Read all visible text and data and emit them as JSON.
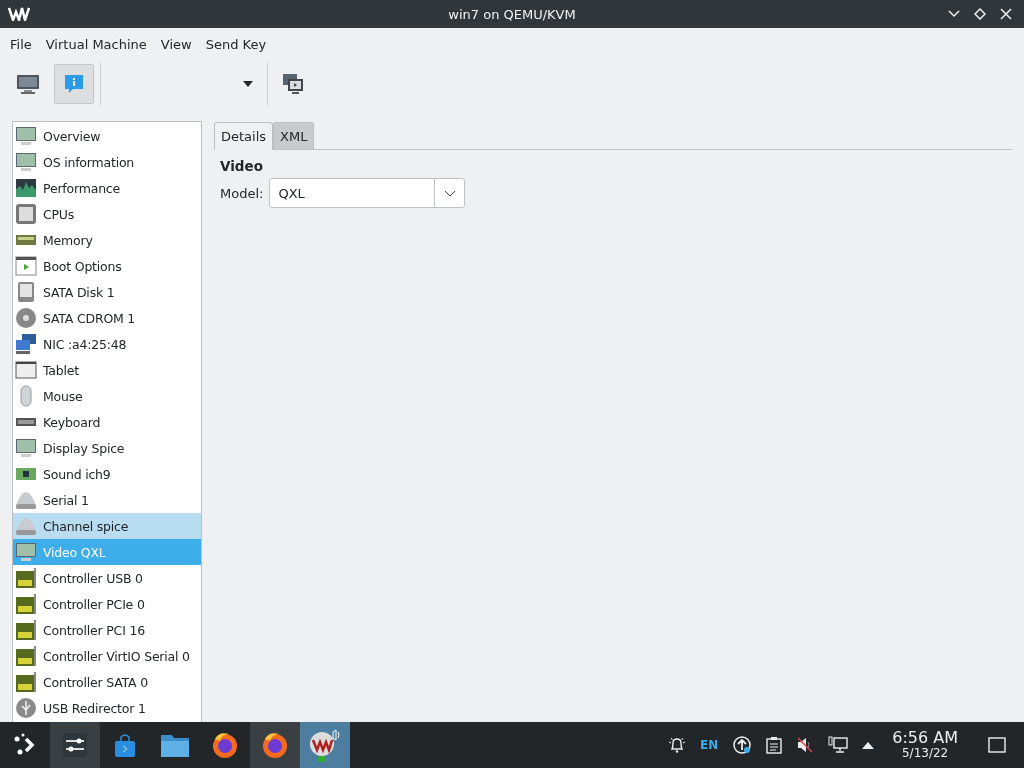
{
  "window": {
    "title": "win7 on QEMU/KVM"
  },
  "menu": [
    "File",
    "Virtual Machine",
    "View",
    "Send Key"
  ],
  "toolbar": {
    "buttons": [
      {
        "kind": "console",
        "selected": false
      },
      {
        "kind": "details",
        "selected": true
      }
    ],
    "dropdown": {
      "kind": "dropdown"
    },
    "extra": {
      "kind": "screens"
    }
  },
  "hardware": [
    {
      "label": "Overview",
      "kind": "monitor",
      "selected": false,
      "hovered": false
    },
    {
      "label": "OS information",
      "kind": "monitor",
      "selected": false,
      "hovered": false
    },
    {
      "label": "Performance",
      "kind": "chart",
      "selected": false,
      "hovered": false
    },
    {
      "label": "CPUs",
      "kind": "chip",
      "selected": false,
      "hovered": false
    },
    {
      "label": "Memory",
      "kind": "memory",
      "selected": false,
      "hovered": false
    },
    {
      "label": "Boot Options",
      "kind": "boot",
      "selected": false,
      "hovered": false
    },
    {
      "label": "SATA Disk 1",
      "kind": "disk",
      "selected": false,
      "hovered": false
    },
    {
      "label": "SATA CDROM 1",
      "kind": "cdrom",
      "selected": false,
      "hovered": false
    },
    {
      "label": "NIC :a4:25:48",
      "kind": "nic",
      "selected": false,
      "hovered": false
    },
    {
      "label": "Tablet",
      "kind": "tablet",
      "selected": false,
      "hovered": false
    },
    {
      "label": "Mouse",
      "kind": "mouse",
      "selected": false,
      "hovered": false
    },
    {
      "label": "Keyboard",
      "kind": "keyboard",
      "selected": false,
      "hovered": false
    },
    {
      "label": "Display Spice",
      "kind": "monitor",
      "selected": false,
      "hovered": false
    },
    {
      "label": "Sound ich9",
      "kind": "sound",
      "selected": false,
      "hovered": false
    },
    {
      "label": "Serial 1",
      "kind": "serial",
      "selected": false,
      "hovered": false
    },
    {
      "label": "Channel spice",
      "kind": "serial",
      "selected": false,
      "hovered": true
    },
    {
      "label": "Video QXL",
      "kind": "monitor",
      "selected": true,
      "hovered": false
    },
    {
      "label": "Controller USB 0",
      "kind": "controller",
      "selected": false,
      "hovered": false
    },
    {
      "label": "Controller PCIe 0",
      "kind": "controller",
      "selected": false,
      "hovered": false
    },
    {
      "label": "Controller PCI 16",
      "kind": "controller",
      "selected": false,
      "hovered": false
    },
    {
      "label": "Controller VirtIO Serial 0",
      "kind": "controller",
      "selected": false,
      "hovered": false
    },
    {
      "label": "Controller SATA 0",
      "kind": "controller",
      "selected": false,
      "hovered": false
    },
    {
      "label": "USB Redirector 1",
      "kind": "usb",
      "selected": false,
      "hovered": false
    }
  ],
  "tabs": [
    {
      "label": "Details",
      "selected": true
    },
    {
      "label": "XML",
      "selected": false
    }
  ],
  "section": {
    "title": "Video",
    "field_label": "Model:",
    "value": "QXL"
  },
  "taskbar": {
    "items": [
      {
        "kind": "launcher",
        "active": false
      },
      {
        "kind": "settings",
        "active": true
      },
      {
        "kind": "store",
        "active": false
      },
      {
        "kind": "files",
        "active": false
      },
      {
        "kind": "firefox",
        "active": false
      },
      {
        "kind": "firefox",
        "active": true
      },
      {
        "kind": "virt",
        "active": true
      }
    ],
    "language": "EN",
    "time": "6:56 AM",
    "date": "5/13/22"
  }
}
